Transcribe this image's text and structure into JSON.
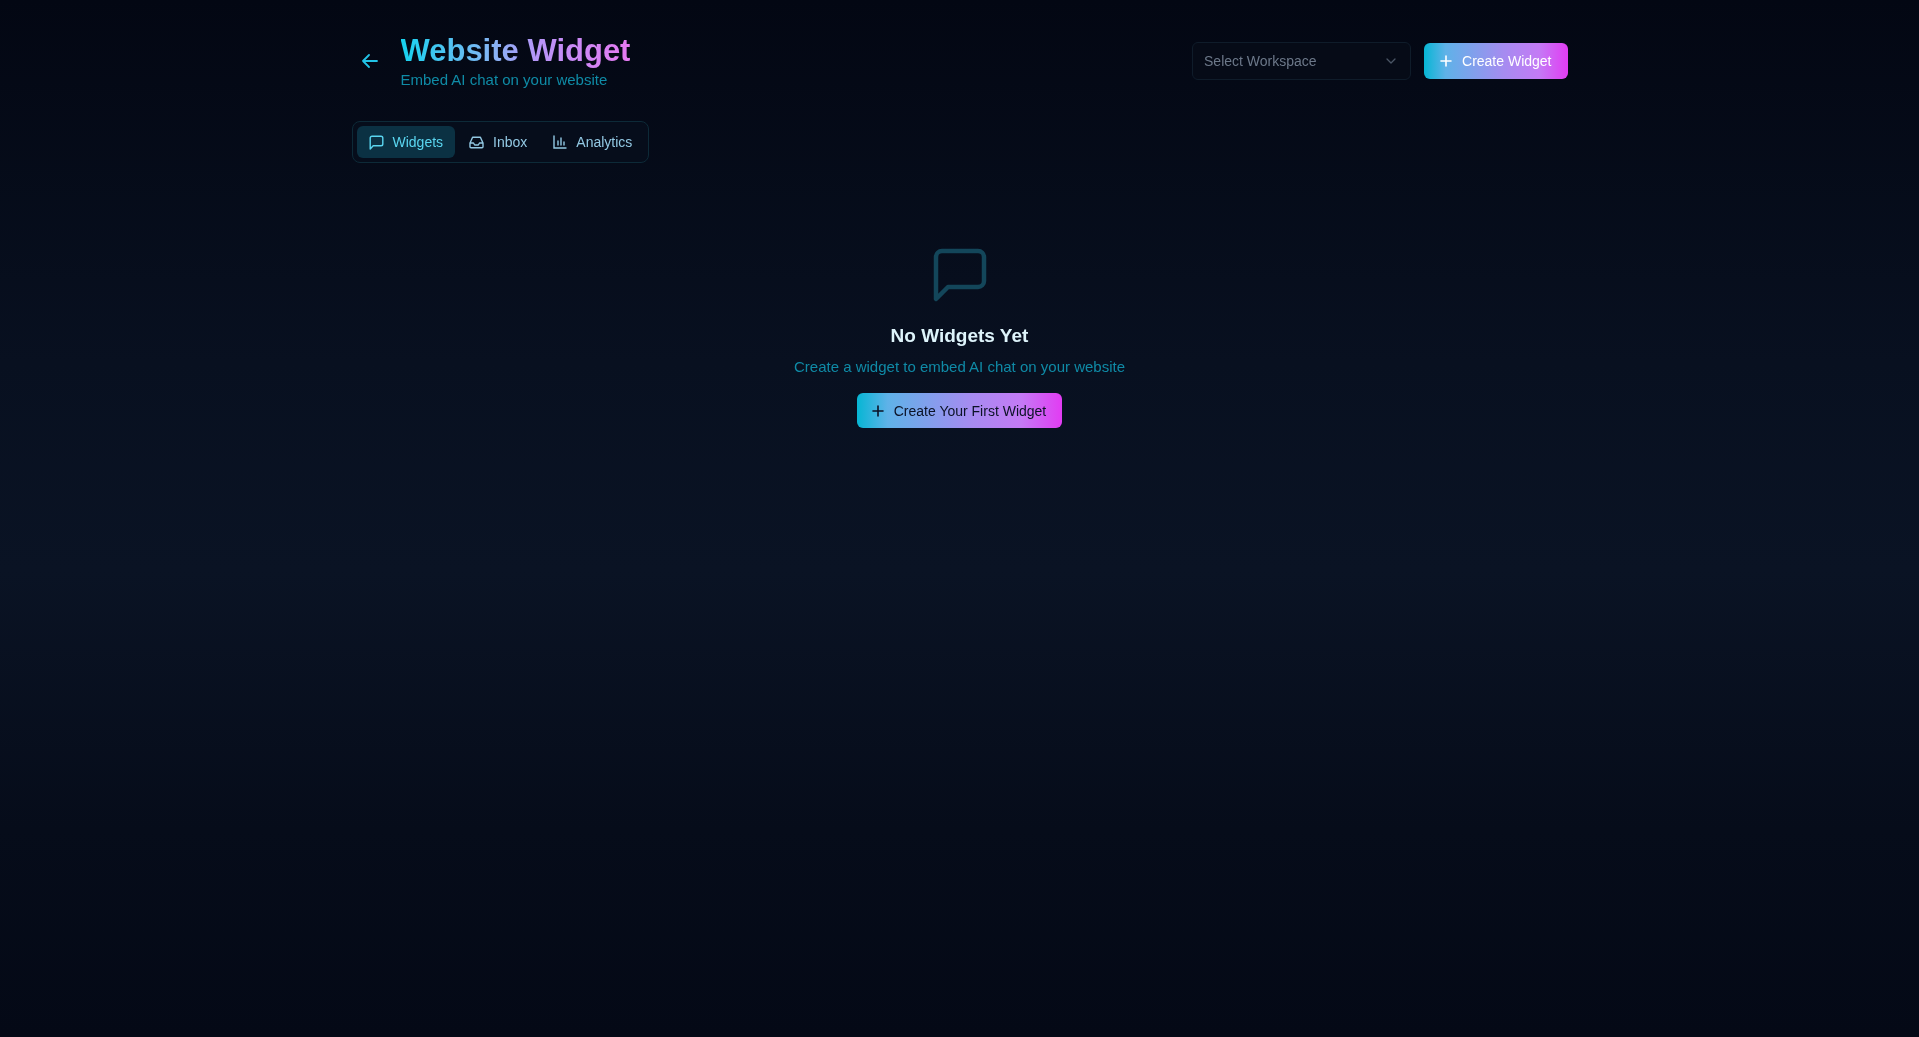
{
  "header": {
    "title": "Website Widget",
    "subtitle": "Embed AI chat on your website"
  },
  "workspace_select": {
    "placeholder": "Select Workspace"
  },
  "create_button": {
    "label": "Create Widget"
  },
  "tabs": [
    {
      "label": "Widgets",
      "selected": true
    },
    {
      "label": "Inbox",
      "selected": false
    },
    {
      "label": "Analytics",
      "selected": false
    }
  ],
  "empty_state": {
    "title": "No Widgets Yet",
    "message": "Create a widget to embed AI chat on your website",
    "button": "Create Your First Widget"
  }
}
